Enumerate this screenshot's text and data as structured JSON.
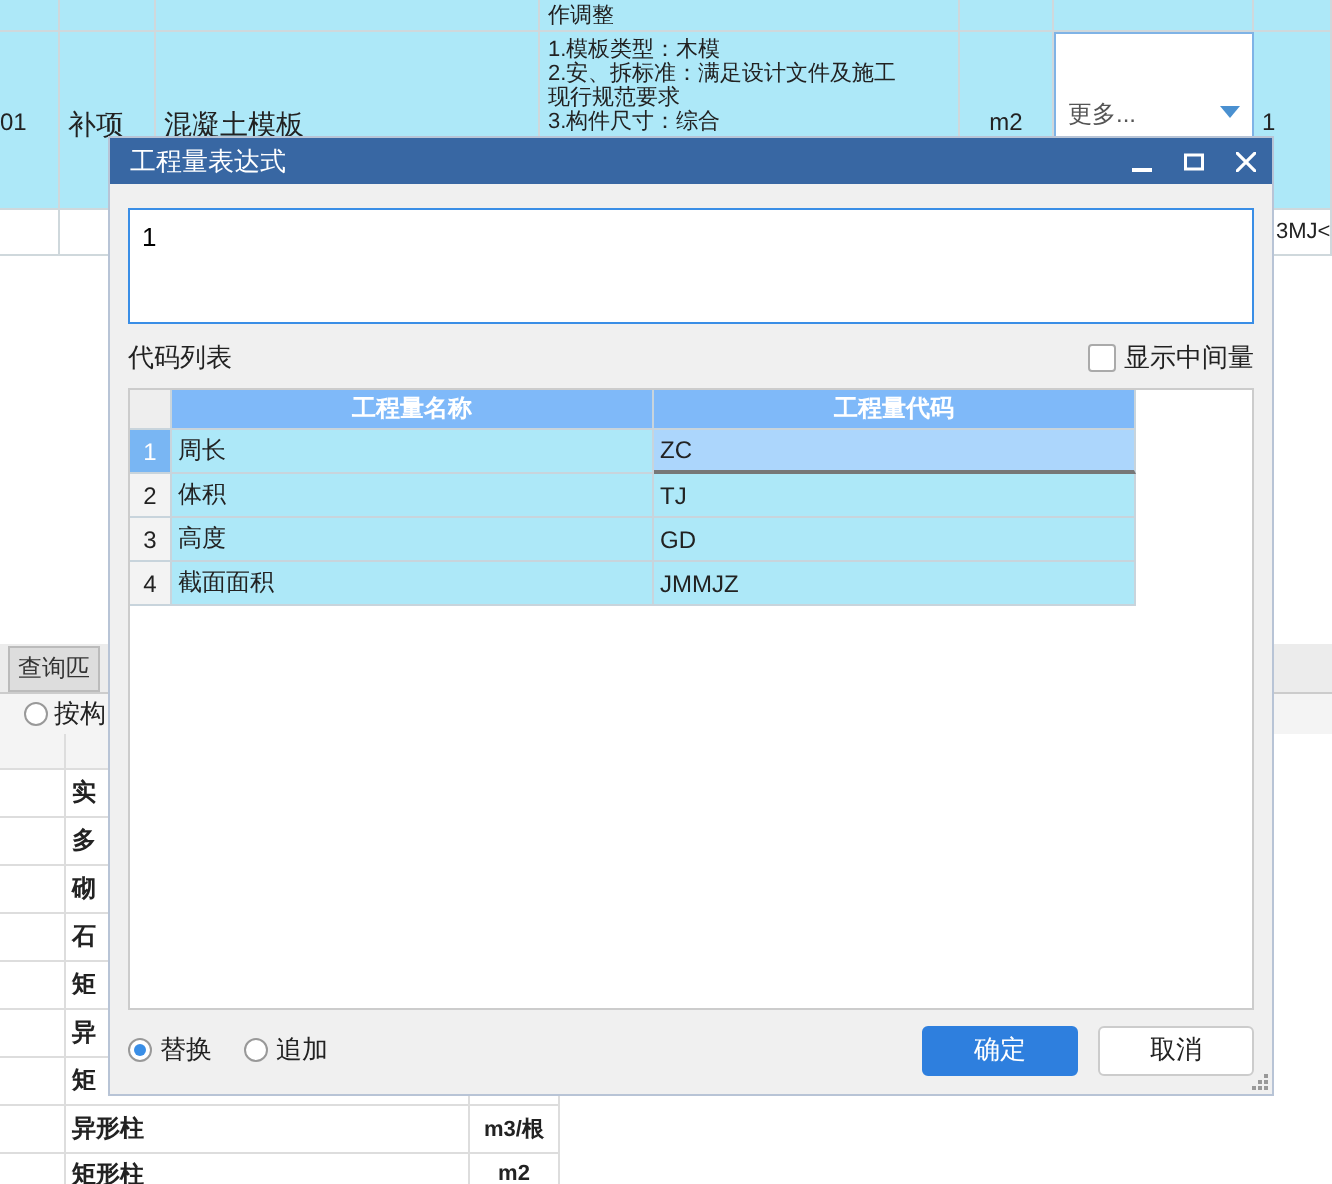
{
  "main_table": {
    "partial_row": {
      "description": "作调整"
    },
    "row": {
      "code": "01",
      "type": "补项",
      "name": "混凝土模板",
      "description": [
        "1.模板类型：木模",
        "2.安、拆标准：满足设计文件及施工",
        "现行规范要求",
        "3.构件尺寸：综合"
      ],
      "unit": "m2",
      "dropdown": "更多...",
      "quantity": "1"
    },
    "next_row": {
      "expression": "3MJ<"
    }
  },
  "lower_panel": {
    "tab": "查询匹",
    "radio": {
      "label": "按构",
      "selected": false
    },
    "rows": [
      {
        "name": "实"
      },
      {
        "name": "多"
      },
      {
        "name": "砌"
      },
      {
        "name": "石"
      },
      {
        "name": "矩"
      },
      {
        "name": "异"
      },
      {
        "name": "矩"
      },
      {
        "name": "异形柱",
        "unit": "m3/根"
      },
      {
        "name": "矩形柱",
        "unit": "m2"
      }
    ]
  },
  "dialog": {
    "title": "工程量表达式",
    "expression": "1",
    "list_label": "代码列表",
    "show_intermediate": {
      "label": "显示中间量",
      "checked": false
    },
    "columns": [
      "工程量名称",
      "工程量代码"
    ],
    "rows": [
      {
        "number": "1",
        "name": "周长",
        "code": "ZC",
        "selected": true
      },
      {
        "number": "2",
        "name": "体积",
        "code": "TJ",
        "selected": false
      },
      {
        "number": "3",
        "name": "高度",
        "code": "GD",
        "selected": false
      },
      {
        "number": "4",
        "name": "截面面积",
        "code": "JMMJZ",
        "selected": false
      }
    ],
    "modes": [
      {
        "label": "替换",
        "selected": true
      },
      {
        "label": "追加",
        "selected": false
      }
    ],
    "buttons": [
      {
        "label": "确定",
        "kind": "primary"
      },
      {
        "label": "取消",
        "kind": "secondary"
      }
    ]
  }
}
